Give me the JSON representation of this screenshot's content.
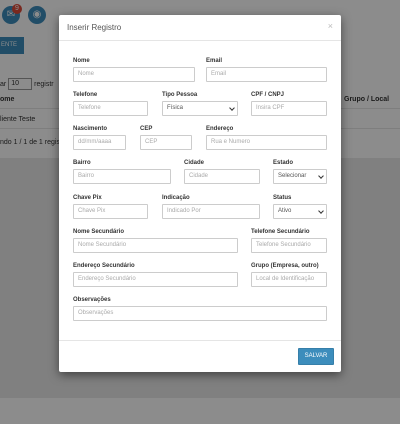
{
  "background": {
    "badge_count": "9",
    "add_button_label": "ENTE",
    "show_prefix": "ar",
    "page_size": "10",
    "show_suffix": "registr",
    "col_name": "ome",
    "col_group": "Grupo / Local",
    "row_name": "liente Teste",
    "pagination_info": "ndo 1 / 1 de 1 registr"
  },
  "modal": {
    "title": "Inserir Registro",
    "close": "×",
    "fields": {
      "nome": {
        "label": "Nome",
        "placeholder": "Nome"
      },
      "email": {
        "label": "Email",
        "placeholder": "Email"
      },
      "telefone": {
        "label": "Telefone",
        "placeholder": "Telefone"
      },
      "tipo_pessoa": {
        "label": "Tipo Pessoa",
        "value": "Física"
      },
      "cpf": {
        "label": "CPF / CNPJ",
        "placeholder": "Insira CPF"
      },
      "nascimento": {
        "label": "Nascimento",
        "placeholder": "dd/mm/aaaa"
      },
      "cep": {
        "label": "CEP",
        "placeholder": "CEP"
      },
      "endereco": {
        "label": "Endereço",
        "placeholder": "Rua e Numero"
      },
      "bairro": {
        "label": "Bairro",
        "placeholder": "Bairro"
      },
      "cidade": {
        "label": "Cidade",
        "placeholder": "Cidade"
      },
      "estado": {
        "label": "Estado",
        "value": "Selecionar"
      },
      "chave_pix": {
        "label": "Chave Pix",
        "placeholder": "Chave Pix"
      },
      "indicacao": {
        "label": "Indicação",
        "placeholder": "Indicado Por"
      },
      "status": {
        "label": "Status",
        "value": "Ativo"
      },
      "nome_sec": {
        "label": "Nome Secundário",
        "placeholder": "Nome Secundário"
      },
      "tel_sec": {
        "label": "Telefone Secundário",
        "placeholder": "Telefone Secundário"
      },
      "end_sec": {
        "label": "Endereço Secundário",
        "placeholder": "Endereço Secundário"
      },
      "grupo": {
        "label": "Grupo (Empresa, outro)",
        "placeholder": "Local de Identificação"
      },
      "obs": {
        "label": "Observações",
        "placeholder": "Observações"
      }
    },
    "save_label": "SALVAR"
  },
  "colors": {
    "primary": "#3c8dbc",
    "badge": "#dd4b39"
  }
}
